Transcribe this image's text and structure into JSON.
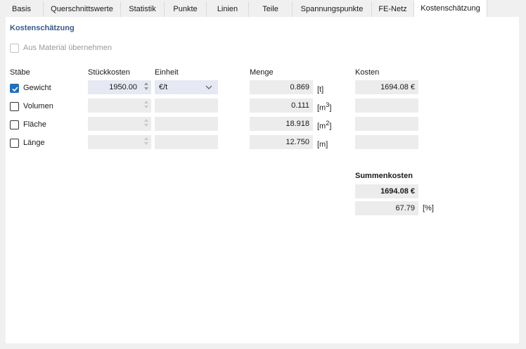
{
  "tabs": [
    "Basis",
    "Querschnittswerte",
    "Statistik",
    "Punkte",
    "Linien",
    "Teile",
    "Spannungspunkte",
    "FE-Netz",
    "Kostenschätzung"
  ],
  "active_tab": "Kostenschätzung",
  "section_title": "Kostenschätzung",
  "material_checkbox": {
    "label": "Aus Material übernehmen",
    "checked": false,
    "enabled": false
  },
  "headers": {
    "staebe": "Stäbe",
    "stueckkosten": "Stückkosten",
    "einheit": "Einheit",
    "menge": "Menge",
    "kosten": "Kosten"
  },
  "rows": [
    {
      "label": "Gewicht",
      "checked": true,
      "stueckkosten": "1950.00",
      "einheit": "€/t",
      "menge": "0.869",
      "unit_base": "[t]",
      "unit_sup": "",
      "unit_end": "",
      "kosten": "1694.08 €"
    },
    {
      "label": "Volumen",
      "checked": false,
      "stueckkosten": "",
      "einheit": "",
      "menge": "0.111",
      "unit_base": "[m",
      "unit_sup": "3",
      "unit_end": "]",
      "kosten": ""
    },
    {
      "label": "Fläche",
      "checked": false,
      "stueckkosten": "",
      "einheit": "",
      "menge": "18.918",
      "unit_base": "[m",
      "unit_sup": "2",
      "unit_end": "]",
      "kosten": ""
    },
    {
      "label": "Länge",
      "checked": false,
      "stueckkosten": "",
      "einheit": "",
      "menge": "12.750",
      "unit_base": "[m]",
      "unit_sup": "",
      "unit_end": "",
      "kosten": ""
    }
  ],
  "summary": {
    "title": "Summenkosten",
    "total": "1694.08 €",
    "percent": "67.79",
    "percent_unit": "[%]"
  },
  "colors": {
    "accent": "#1f6fc5",
    "section_title": "#3a5a8c",
    "field_bg": "#ececec",
    "active_field_bg": "#e6e9f3"
  }
}
